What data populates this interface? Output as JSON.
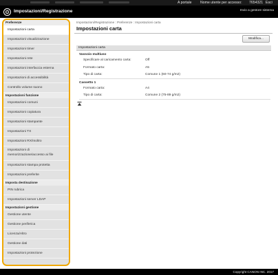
{
  "topbar": {
    "portal_link": "A portale",
    "user_label": "Nome utente per accesso:",
    "user_value": "7654321",
    "logout_link": "Esci"
  },
  "header": {
    "title": "Impostazioni/Registrazione",
    "back_link": "Invio a gestore sistema"
  },
  "sidebar": {
    "sections": [
      {
        "heading": "Preferenze",
        "items": [
          "Impostazioni carta",
          "Impostazioni visualizzazione",
          "Impostazioni timer",
          "Impostazioni rete",
          "Impostazioni interfaccia esterna",
          "Impostazioni di accessibilità",
          "Controllo volume suono"
        ]
      },
      {
        "heading": "Impostazioni funzione",
        "items": [
          "Impostazioni comuni",
          "Impostazioni copiatura",
          "Impostazioni stampante",
          "Impostazioni TX",
          "Impostazioni RX/Inoltro",
          "Impostazioni di memorizzazione/accesso ai file",
          "Impostazioni stampa protetta",
          "Impostazioni preferite"
        ]
      },
      {
        "heading": "Imposta destinazione",
        "items": [
          "PIN rubrica",
          "Impostazioni server LDAP"
        ]
      },
      {
        "heading": "Impostazioni gestione",
        "items": [
          "Gestione utente",
          "Gestione periferica",
          "Licenza/Altro",
          "Gestione dati",
          "Impostazioni protezione"
        ]
      }
    ]
  },
  "main": {
    "breadcrumb": "Impostazioni/Registrazione : Preferenze : Impostazioni carta",
    "title": "Impostazioni carta",
    "modify_button": "Modifica...",
    "section_title": "Impostazioni carta",
    "groups": [
      {
        "name": "Vassoio multiuso",
        "rows": [
          {
            "label": "Specificare al caricamento carta:",
            "value": "Off"
          },
          {
            "label": "Formato carta:",
            "value": "A5"
          },
          {
            "label": "Tipo di carta:",
            "value": "Comune 1 (60-74 g/m2)"
          }
        ]
      },
      {
        "name": "Cassetto 1",
        "rows": [
          {
            "label": "Formato carta:",
            "value": "A4"
          },
          {
            "label": "Tipo di carta:",
            "value": "Comune 2 (75-89 g/m2)"
          }
        ]
      }
    ]
  },
  "footer": {
    "copyright": "Copyright CANON INC. 2017"
  },
  "colors": {
    "sidebar_highlight_border": "#f0a800",
    "header_background": "#000000",
    "sidebar_background": "#e0e0e0",
    "active_item_background": "#ffffff"
  },
  "icons": [
    "canon-settings-logo-icon",
    "back-to-top-icon"
  ]
}
